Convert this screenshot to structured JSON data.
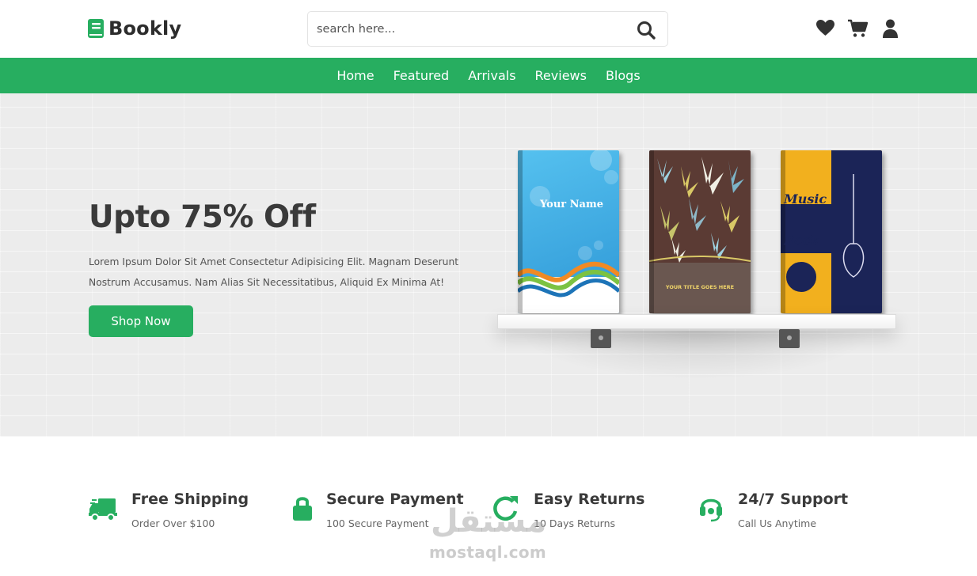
{
  "brand": {
    "name": "Bookly",
    "accent": "#27ae60",
    "logo_icon": "book-icon"
  },
  "search": {
    "placeholder": "search here...",
    "value": "",
    "icon": "search-icon"
  },
  "header_icons": [
    {
      "name": "heart-icon"
    },
    {
      "name": "cart-icon"
    },
    {
      "name": "user-icon"
    }
  ],
  "nav": {
    "items": [
      "Home",
      "Featured",
      "Arrivals",
      "Reviews",
      "Blogs"
    ]
  },
  "hero": {
    "title": "Upto 75% Off",
    "text": "Lorem Ipsum Dolor Sit Amet Consectetur Adipisicing Elit. Magnam Deserunt Nostrum Accusamus. Nam Alias Sit Necessitatibus, Aliquid Ex Minima At!",
    "button": "Shop Now",
    "books": [
      {
        "cover_text": "Your Name",
        "color": "#3aa9e0"
      },
      {
        "cover_text": "YOUR TITLE GOES HERE",
        "color": "#5b3b34"
      },
      {
        "cover_text": "Music Rock",
        "color": "#f2b01e"
      }
    ]
  },
  "features": [
    {
      "icon": "truck-icon",
      "title": "Free Shipping",
      "subtitle": "Order Over $100"
    },
    {
      "icon": "lock-icon",
      "title": "Secure Payment",
      "subtitle": "100 Secure Payment"
    },
    {
      "icon": "redo-icon",
      "title": "Easy Returns",
      "subtitle": "10 Days Returns"
    },
    {
      "icon": "headset-icon",
      "title": "24/7 Support",
      "subtitle": "Call Us Anytime"
    }
  ],
  "watermark": {
    "arabic": "مستقل",
    "latin": "mostaql.com"
  }
}
